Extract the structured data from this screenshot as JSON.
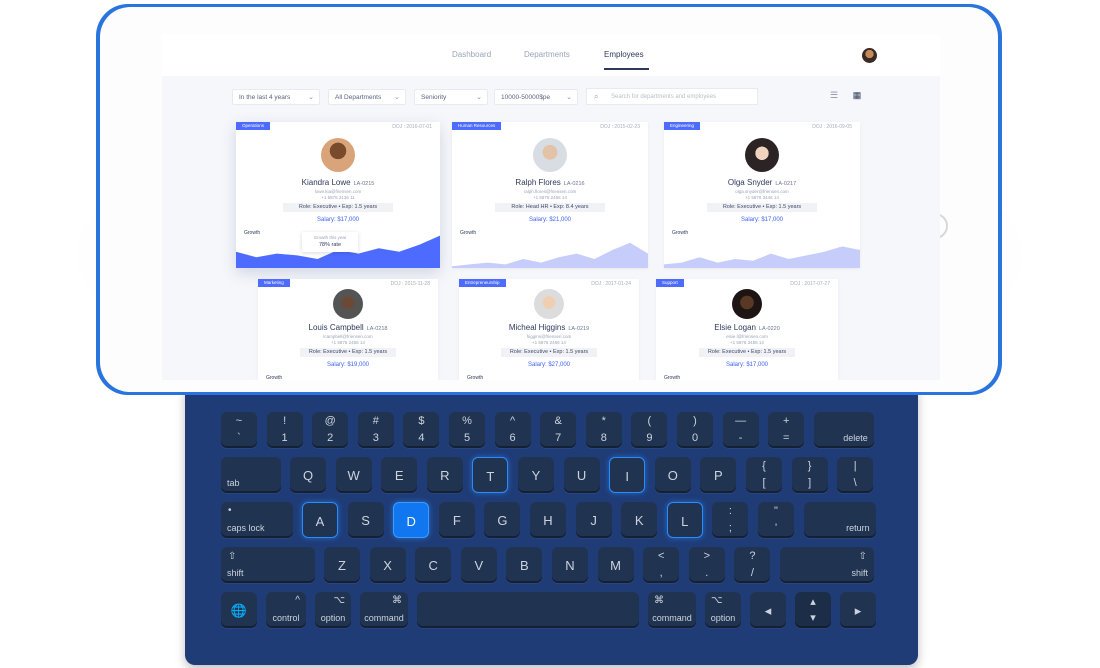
{
  "nav": {
    "items": [
      "Dashboard",
      "Departments",
      "Employees"
    ],
    "active": "Employees"
  },
  "filters": {
    "period": "In the last 4 years",
    "department": "All Departments",
    "seniority": "Seniority",
    "salary": "10000-50000$pe",
    "search_placeholder": "Search for departments and employees"
  },
  "labels": {
    "growth": "Growth"
  },
  "cards": [
    {
      "dept": "Operations",
      "doj": "DOJ : 2016-07-01",
      "name": "Kiandra Lowe",
      "id": "LA-0215",
      "email": "lowe.kia@friensen.com",
      "phone": "+1 5876 3136 11",
      "role": "Role: Executive • Exp: 1.5 years",
      "salary": "Salary: $17,000",
      "tooltip_title": "Growth this year",
      "tooltip_value": "78% rate",
      "accent": "#4d6bff"
    },
    {
      "dept": "Human Resources",
      "doj": "DOJ : 2015-02-23",
      "name": "Ralph Flores",
      "id": "LA-0216",
      "email": "ralph.flores@friensen.com",
      "phone": "+1 5876 2456 14",
      "role": "Role: Head HR • Exp: 8.4 years",
      "salary": "Salary: $21,000",
      "accent": "#c7cdfb"
    },
    {
      "dept": "Engineering",
      "doj": "DOJ : 2016-09-05",
      "name": "Olga Snyder",
      "id": "LA-0217",
      "email": "olga.snyder@friensen.com",
      "phone": "+1 5876 3446 14",
      "role": "Role: Executive • Exp: 1.5 years",
      "salary": "Salary: $17,000",
      "accent": "#c7cdfb"
    },
    {
      "dept": "Marketing",
      "doj": "DOJ : 2015-11-28",
      "name": "Louis Campbell",
      "id": "LA-0218",
      "email": "lcampbell@friensen.com",
      "phone": "+1 5876 2456 14",
      "role": "Role: Executive • Exp: 1.5 years",
      "salary": "Salary: $19,000",
      "accent": "#c7cdfb"
    },
    {
      "dept": "Entrepreneurship",
      "doj": "DOJ : 2017-01-24",
      "name": "Micheal Higgins",
      "id": "LA-0219",
      "email": "higgins@friensen.com",
      "phone": "+1 5876 2456 14",
      "role": "Role: Executive • Exp: 1.5 years",
      "salary": "Salary: $27,000",
      "accent": "#c7cdfb"
    },
    {
      "dept": "Support",
      "doj": "DOJ : 2017-07-27",
      "name": "Elsie Logan",
      "id": "LA-0220",
      "email": "elsie.l@friensen.com",
      "phone": "+1 5876 3456 14",
      "role": "Role: Executive • Exp: 1.5 years",
      "salary": "Salary: $17,000",
      "accent": "#c7cdfb"
    }
  ],
  "keyboard": {
    "row1": [
      [
        "~",
        "`"
      ],
      [
        "!",
        "1"
      ],
      [
        "@",
        "2"
      ],
      [
        "#",
        "3"
      ],
      [
        "$",
        "4"
      ],
      [
        "%",
        "5"
      ],
      [
        "^",
        "6"
      ],
      [
        "&",
        "7"
      ],
      [
        "*",
        "8"
      ],
      [
        "(",
        "9"
      ],
      [
        ")",
        "0"
      ],
      [
        "—",
        "-"
      ],
      [
        "+",
        "="
      ]
    ],
    "delete": "delete",
    "tab": "tab",
    "row2": [
      "Q",
      "W",
      "E",
      "R",
      "T",
      "Y",
      "U",
      "I",
      "O",
      "P"
    ],
    "brackets": [
      [
        "{",
        "["
      ],
      [
        "}",
        "]"
      ],
      [
        "|",
        "\\"
      ]
    ],
    "caps": "caps lock",
    "row3": [
      "A",
      "S",
      "D",
      "F",
      "G",
      "H",
      "J",
      "K",
      "L"
    ],
    "punct3": [
      [
        ":",
        ";"
      ],
      [
        "\"",
        "'"
      ]
    ],
    "return": "return",
    "shift": "shift",
    "row4": [
      "Z",
      "X",
      "C",
      "V",
      "B",
      "N",
      "M"
    ],
    "punct4": [
      [
        "<",
        ","
      ],
      [
        ">",
        "."
      ],
      [
        "?",
        "/"
      ]
    ],
    "control": "control",
    "option": "option",
    "command": "command",
    "globe": "🌐",
    "arrows": [
      "◂",
      "▴",
      "▾",
      "▸"
    ],
    "highlighted_outline": [
      "T",
      "I",
      "A",
      "L"
    ],
    "highlighted_fill": [
      "D"
    ]
  }
}
